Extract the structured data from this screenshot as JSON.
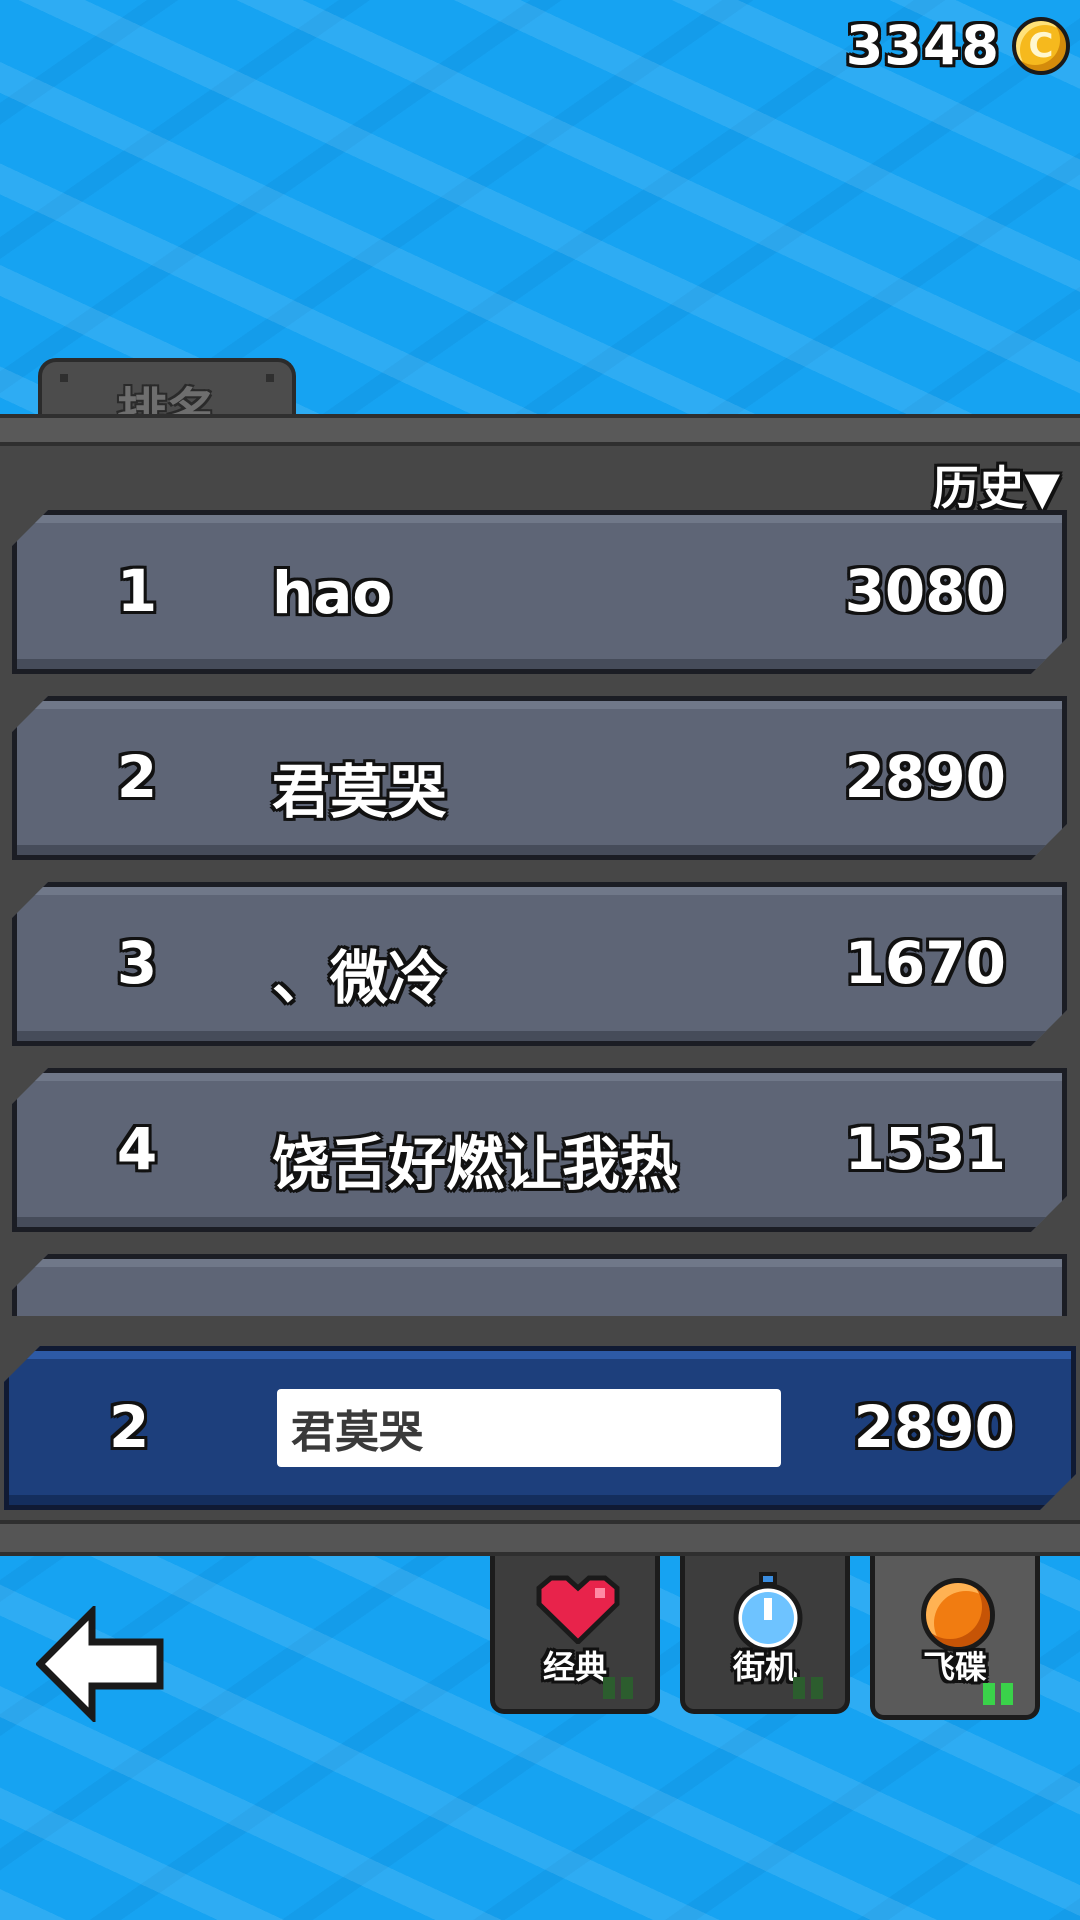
{
  "coins": {
    "count": "3348",
    "icon": "coin-icon",
    "coin_symbol": "C"
  },
  "panel": {
    "tab_label": "排名",
    "filter_label": "历史▼"
  },
  "leaderboard": [
    {
      "rank": "1",
      "name": "hao",
      "score": "3080"
    },
    {
      "rank": "2",
      "name": "君莫哭",
      "score": "2890"
    },
    {
      "rank": "3",
      "name": "、微冷",
      "score": "1670"
    },
    {
      "rank": "4",
      "name": "饶舌好燃让我热",
      "score": "1531"
    }
  ],
  "my_entry": {
    "rank": "2",
    "name": "君莫哭",
    "score": "2890"
  },
  "modes": [
    {
      "label": "经典",
      "icon": "heart-icon"
    },
    {
      "label": "街机",
      "icon": "stopwatch-icon"
    },
    {
      "label": "飞碟",
      "icon": "disc-icon",
      "active": true
    }
  ],
  "back_icon": "back-arrow-icon",
  "colors": {
    "background": "#16a3f2",
    "row": "#5e6576",
    "my_row": "#1d3f7c",
    "active_pip": "#3ad24a"
  }
}
